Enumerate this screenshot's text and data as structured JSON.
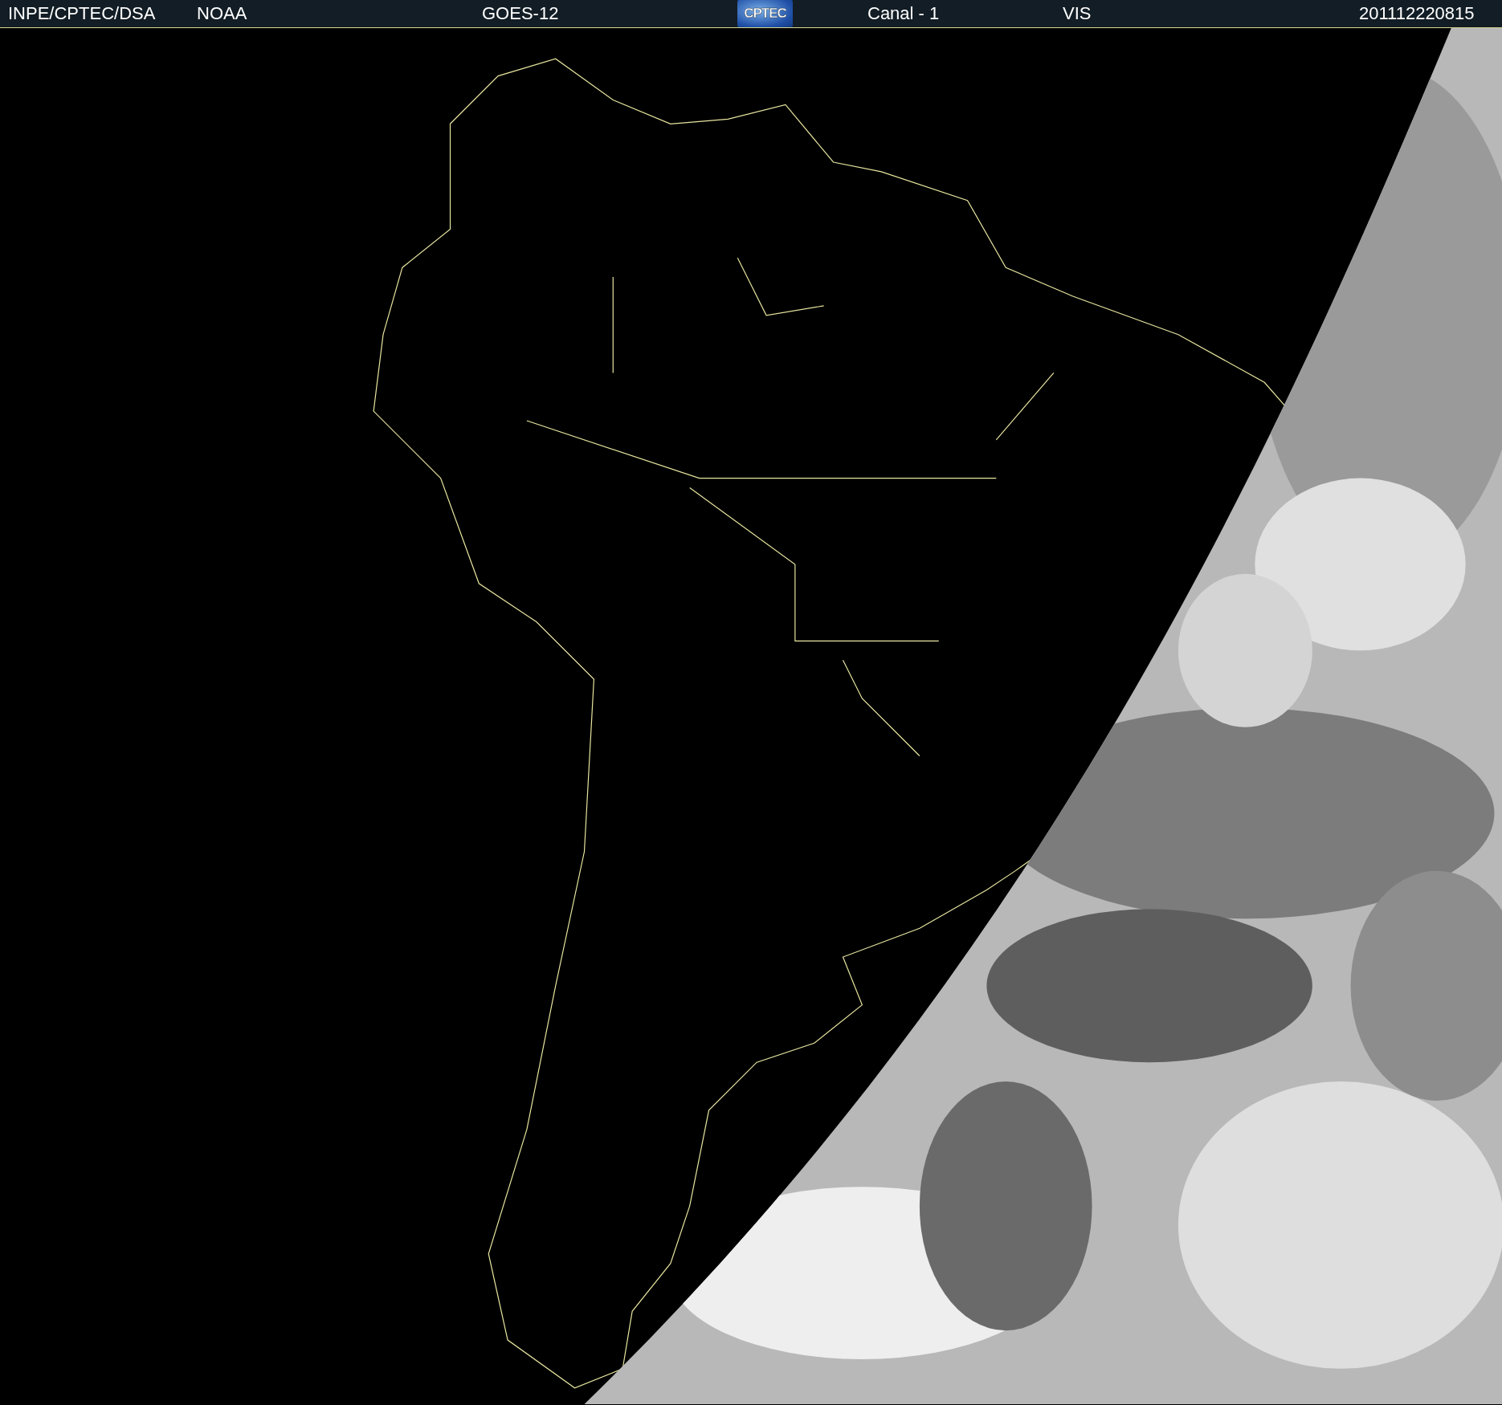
{
  "header": {
    "items": [
      {
        "kind": "text",
        "text": "INPE/CPTEC/DSA"
      },
      {
        "kind": "text",
        "text": "NOAA"
      },
      {
        "kind": "text",
        "text": "GOES-12"
      },
      {
        "kind": "logo",
        "text": "CPTEC"
      },
      {
        "kind": "text",
        "text": "Canal - 1"
      },
      {
        "kind": "text",
        "text": "VIS"
      },
      {
        "kind": "text",
        "text": "201112220815"
      }
    ]
  }
}
